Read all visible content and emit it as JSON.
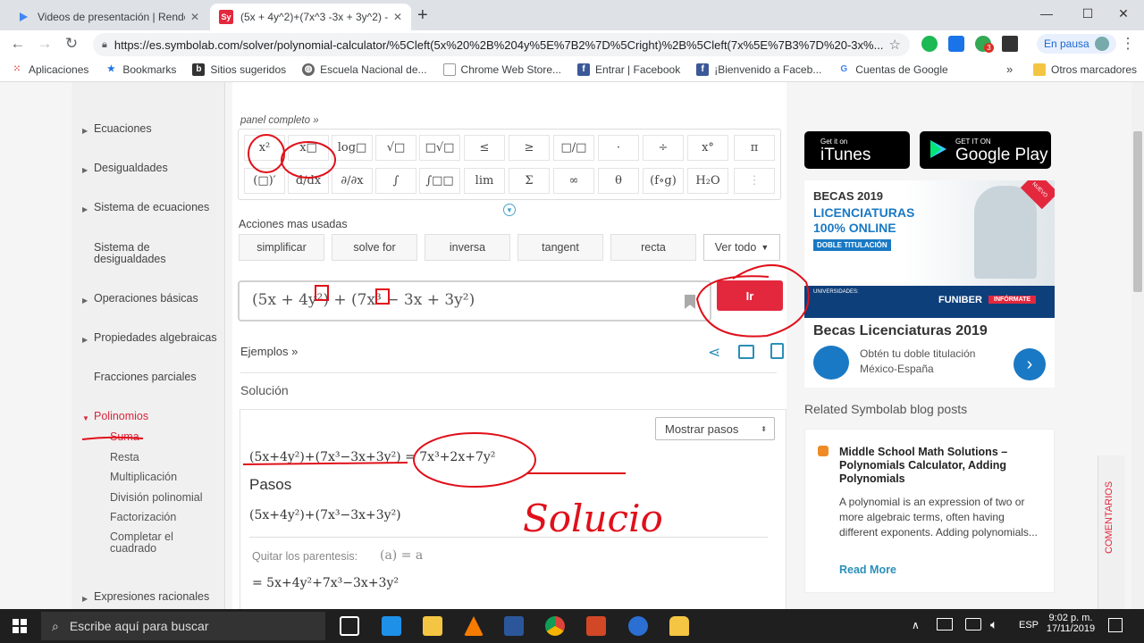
{
  "browser": {
    "tabs": [
      {
        "title": "Videos de presentación | Render",
        "favicon": "play-icon",
        "active": false
      },
      {
        "title": "(5x + 4y^2)+(7x^3 -3x + 3y^2) -",
        "favicon_text": "Sy",
        "active": true
      }
    ],
    "new_tab_symbol": "+",
    "url": "https://es.symbolab.com/solver/polynomial-calculator/%5Cleft(5x%20%2B%204y%5E%7B2%7D%5Cright)%2B%5Cleft(7x%5E%7B3%7D%20-3x%...",
    "profile_label": "En pausa",
    "ext_badge": "3",
    "bookmarks": [
      "Aplicaciones",
      "Bookmarks",
      "Sitios sugeridos",
      "Escuela Nacional de...",
      "Chrome Web Store...",
      "Entrar | Facebook",
      "¡Bienvenido a Faceb...",
      "Cuentas de Google"
    ],
    "bookmarks_more": "»",
    "other_bookmarks": "Otros marcadores"
  },
  "sidebar": {
    "items": [
      {
        "label": "Ecuaciones",
        "arrow": true
      },
      {
        "label": "Desigualdades",
        "arrow": true
      },
      {
        "label": "Sistema de ecuaciones",
        "arrow": true
      },
      {
        "label": "Sistema de desigualdades",
        "arrow": false
      },
      {
        "label": "Operaciones básicas",
        "arrow": true
      },
      {
        "label": "Propiedades algebraicas",
        "arrow": true
      },
      {
        "label": "Fracciones parciales",
        "arrow": false
      },
      {
        "label": "Polinomios",
        "arrow": true,
        "active": true
      },
      {
        "label": "Expresiones racionales",
        "arrow": true
      }
    ],
    "subitems": [
      "Suma",
      "Resta",
      "Multiplicación",
      "División polinomial",
      "Factorización",
      "Completar el cuadrado"
    ]
  },
  "keyboard": {
    "panel_link": "panel completo »",
    "row1": [
      "x²",
      "x□",
      "log□",
      "√□",
      "□√□",
      "≤",
      "≥",
      "□/□",
      "·",
      "÷",
      "x°",
      "π"
    ],
    "row2": [
      "(□)′",
      "d/dx",
      "∂/∂x",
      "∫",
      "∫□□",
      "lim",
      "Σ",
      "∞",
      "θ",
      "(f∘g)",
      "H₂O",
      "⋮"
    ]
  },
  "actions": {
    "title": "Acciones mas usadas",
    "buttons": [
      "simplificar",
      "solve for",
      "inversa",
      "tangent",
      "recta"
    ],
    "see_all": "Ver todo"
  },
  "input": {
    "expression": "(5x + 4y²) + (7x³ − 3x + 3y²)"
  },
  "go_button": "Ir",
  "examples_link": "Ejemplos »",
  "solution": {
    "heading": "Solución",
    "show_steps": "Mostrar pasos",
    "result": "(5x+4y²)+(7x³−3x+3y²) = 7x³+2x+7y²",
    "steps_title": "Pasos",
    "step_expr": "(5x+4y²)+(7x³−3x+3y²)",
    "step_label": "Quitar los parentesis:",
    "step_rule": "(a) = a",
    "step_result": "= 5x+4y²+7x³−3x+3y²"
  },
  "annotation": {
    "handwriting": "Solucio"
  },
  "ads": {
    "itunes_small": "Get it on",
    "itunes_big": "iTunes",
    "gplay_small": "GET IT ON",
    "gplay_big": "Google Play",
    "ad_title": "BECAS 2019",
    "ad_line1": "LICENCIATURAS",
    "ad_line2": "100% ONLINE",
    "ad_badge": "DOBLE TITULACIÓN",
    "ad_uni": "UNIVERSIDADES:",
    "ad_brand": "FUNIBER",
    "ad_info": "INFÓRMATE",
    "ad_headline": "Becas Licenciaturas 2019",
    "ad_desc": "Obtén tu doble titulación México-España",
    "ad_corner": "NUEVO"
  },
  "blog": {
    "heading": "Related Symbolab blog posts",
    "post_title": "Middle School Math Solutions – Polynomials Calculator, Adding Polynomials",
    "post_body": "A polynomial is an expression of two or more algebraic terms, often having different exponents. Adding polynomials...",
    "read_more": "Read More"
  },
  "comments_tab": "COMENTARIOS",
  "taskbar": {
    "search_placeholder": "Escribe aquí para buscar",
    "lang": "ESP",
    "time": "9:02 p. m.",
    "date": "17/11/2019"
  },
  "colors": {
    "accent_red": "#e3283e",
    "ink_red": "#e0101a",
    "blog_orange": "#f08a24",
    "ad_blue": "#0d3f7a"
  }
}
